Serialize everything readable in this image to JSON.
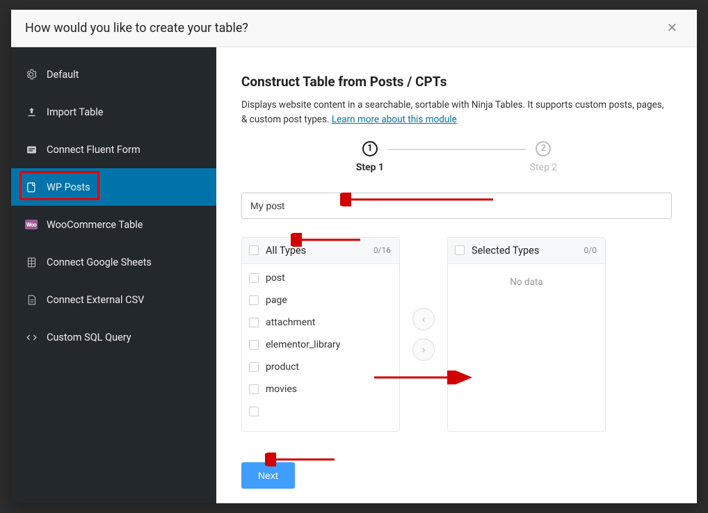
{
  "header": {
    "title": "How would you like to create your table?"
  },
  "sidebar": {
    "items": [
      {
        "label": "Default"
      },
      {
        "label": "Import Table"
      },
      {
        "label": "Connect Fluent Form"
      },
      {
        "label": "WP Posts"
      },
      {
        "label": "WooCommerce Table"
      },
      {
        "label": "Connect Google Sheets"
      },
      {
        "label": "Connect External CSV"
      },
      {
        "label": "Custom SQL Query"
      }
    ]
  },
  "main": {
    "heading": "Construct Table from Posts / CPTs",
    "description_pre": "Displays website content in a searchable, sortable with Ninja Tables. It supports custom posts, pages, & custom post types. ",
    "description_link": "Learn more about this module",
    "steps": {
      "s1": "Step 1",
      "s2": "Step 2",
      "n1": "1",
      "n2": "2"
    },
    "title_input_value": "My post",
    "all_types": {
      "title": "All Types",
      "count": "0/16",
      "items": [
        "post",
        "page",
        "attachment",
        "elementor_library",
        "product",
        "movies"
      ]
    },
    "selected_types": {
      "title": "Selected Types",
      "count": "0/0",
      "empty": "No data"
    },
    "next": "Next"
  }
}
